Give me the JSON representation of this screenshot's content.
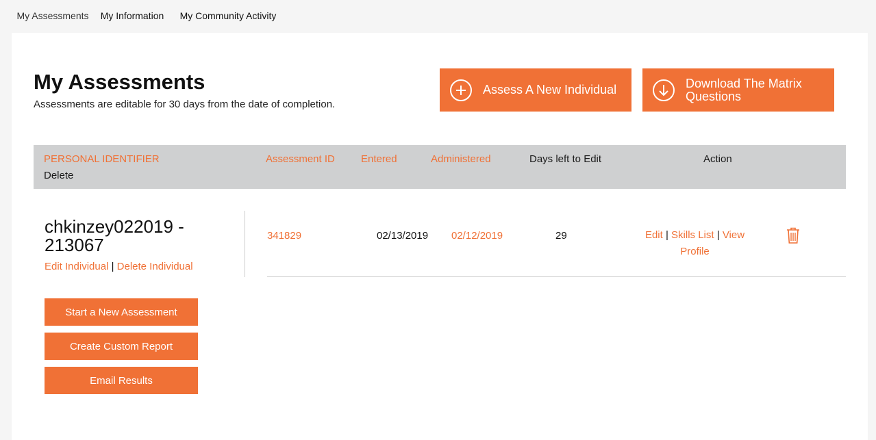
{
  "nav": {
    "tabs": [
      {
        "label": "My Assessments",
        "active": true
      },
      {
        "label": "My Information",
        "active": false
      },
      {
        "label": "My Community Activity",
        "active": false
      }
    ]
  },
  "page": {
    "title": "My Assessments",
    "subtitle": "Assessments are editable for 30 days from the date of completion."
  },
  "buttons": {
    "assess_new": "Assess A New Individual",
    "download_matrix": "Download The Matrix Questions"
  },
  "table": {
    "headers": {
      "personal_identifier": "PERSONAL IDENTIFIER",
      "delete": "Delete",
      "assessment_id": "Assessment ID",
      "entered": "Entered",
      "administered": "Administered",
      "days_left": "Days left to Edit",
      "action": "Action"
    }
  },
  "individual": {
    "name": "chkinzey022019 - 213067",
    "edit_label": "Edit Individual",
    "separator": "|",
    "delete_label": "Delete Individual",
    "assessment": {
      "id": "341829",
      "entered": "02/13/2019",
      "administered": "02/12/2019",
      "days_left": "29",
      "actions": {
        "edit": "Edit",
        "skills_list": "Skills List",
        "view_profile": "View Profile",
        "separator": "|"
      }
    }
  },
  "side_buttons": {
    "start_new": "Start a New Assessment",
    "custom_report": "Create Custom Report",
    "email_results": "Email Results"
  },
  "icons": {
    "assess_icon": "plus-circle-icon",
    "download_icon": "arrow-down-circle-icon",
    "delete_icon": "trash-icon"
  },
  "colors": {
    "accent": "#f07136",
    "header_bg": "#cfd0d1"
  }
}
